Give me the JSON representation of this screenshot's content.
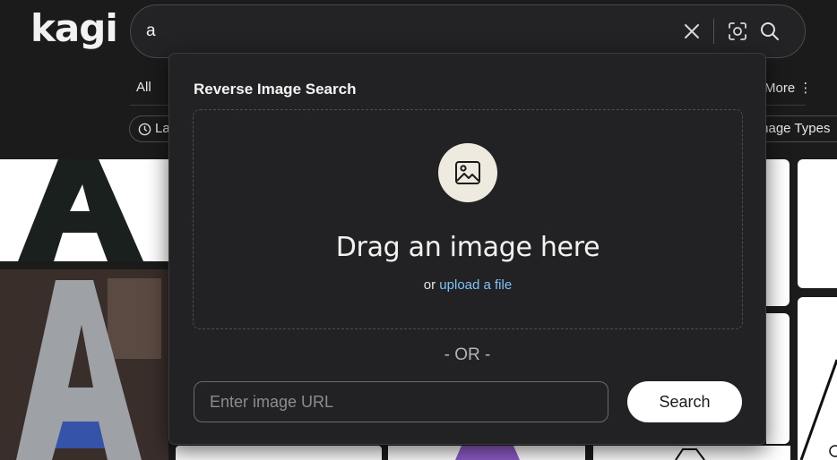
{
  "header": {
    "logo_text": "kagi",
    "search_query": "a",
    "clear_icon": "close-icon",
    "camera_icon": "image-search-icon",
    "search_icon": "search-icon"
  },
  "nav": {
    "all_label": "All",
    "more_label": "More ⋮"
  },
  "filters": {
    "left_chip_label": "La",
    "right_chip_label": "mage Types"
  },
  "popup": {
    "title": "Reverse Image Search",
    "drag_text": "Drag an image here",
    "or_prefix": "or ",
    "upload_link": "upload a file",
    "or_separator": "- OR -",
    "url_placeholder": "Enter image URL",
    "search_button": "Search",
    "image_icon": "image-icon"
  },
  "colors": {
    "background": "#1b1b1c",
    "popup_bg": "#222224",
    "link": "#7cc4f5",
    "button_bg": "#ffffff"
  }
}
